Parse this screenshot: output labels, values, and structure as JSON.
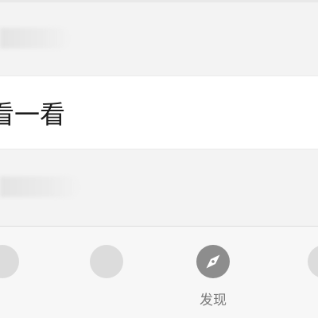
{
  "menu": {
    "look_label": "看一看"
  },
  "tab_bar": {
    "tabs": [
      {
        "label": "",
        "icon": "tab-icon-placeholder",
        "active": false
      },
      {
        "label": "",
        "icon": "tab-icon-placeholder",
        "active": false
      },
      {
        "label": "发现",
        "icon": "compass-icon",
        "active": true
      },
      {
        "label": "",
        "icon": "tab-icon-placeholder",
        "active": false
      }
    ]
  },
  "colors": {
    "background": "#f3f3f3",
    "row_background": "#ffffff",
    "active_icon": "#8d8d8d",
    "inactive_icon": "#dcdcdc",
    "tab_label": "#7a7a7a"
  }
}
